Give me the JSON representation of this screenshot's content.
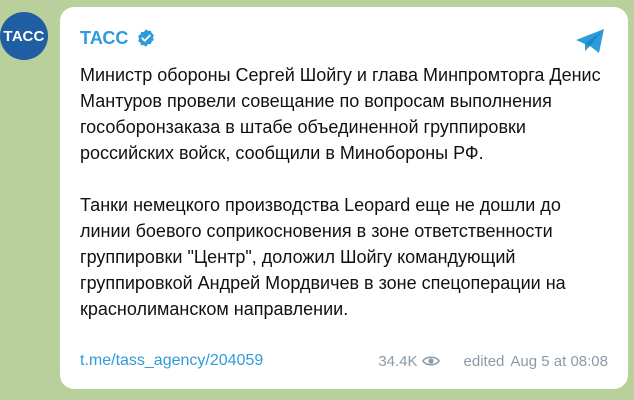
{
  "avatar": {
    "label": "ТАСС"
  },
  "channel": {
    "name": "ТАСС"
  },
  "message": {
    "paragraph1": "Министр обороны Сергей Шойгу и глава Минпромторга Денис Мантуров провели совещание по вопросам выполнения гособоронзаказа в штабе объединенной группировки российских войск, сообщили в Минобороны РФ.",
    "paragraph2": "Танки немецкого производства Leopard еще не дошли до линии боевого соприкосновения в зоне ответственности группировки \"Центр\", доложил Шойгу командующий группировкой Андрей Мордвичев в зоне спецоперации на краснолиманском направлении."
  },
  "footer": {
    "link": "t.me/tass_agency/204059",
    "views": "34.4K",
    "edited_label": "edited",
    "date": "Aug 5 at 08:08"
  },
  "colors": {
    "accent": "#2f9bdb",
    "avatar_bg": "#1f5ea3",
    "meta": "#8a9aa8"
  }
}
